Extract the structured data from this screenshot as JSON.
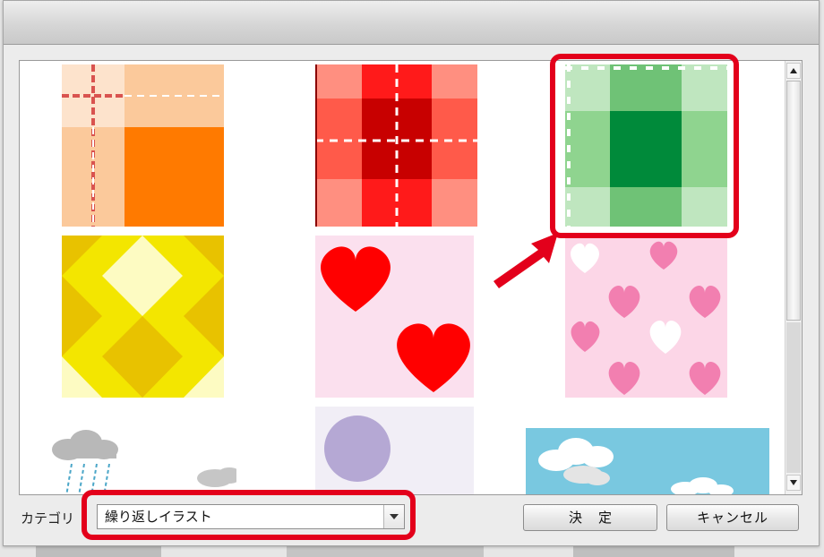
{
  "dialog": {
    "title": ""
  },
  "gallery": {
    "tiles": [
      {
        "name": "orange-stitched-plaid",
        "colors": {
          "base": "#ff7a00",
          "light": "#fbc99b",
          "pale": "#fde3cc",
          "stitch": "#d9534f"
        }
      },
      {
        "name": "red-stitched-plaid",
        "colors": {
          "base": "#ff1a1a",
          "dark": "#c80000",
          "light": "#ff8f80"
        }
      },
      {
        "name": "green-stitched-plaid",
        "colors": {
          "dark": "#008a3a",
          "mid": "#6fc276",
          "light": "#bfe6bf"
        }
      },
      {
        "name": "yellow-argyle",
        "colors": {
          "base": "#f3e600",
          "light": "#fdfbc2",
          "dark": "#e8c200"
        }
      },
      {
        "name": "red-hearts-on-pink",
        "colors": {
          "bg": "#fbe0ee",
          "heart": "#ff0000"
        }
      },
      {
        "name": "pink-hearts-pattern",
        "colors": {
          "bg": "#fcd6e7",
          "heart": "#f27fb0",
          "white": "#ffffff"
        }
      },
      {
        "name": "rain-clouds",
        "colors": {
          "cloud": "#b8b8b8",
          "rain": "#4aa6c8"
        }
      },
      {
        "name": "purple-circle",
        "colors": {
          "bg": "#f1eef6",
          "circle": "#b5a8d4"
        }
      },
      {
        "name": "sky-clouds",
        "colors": {
          "sky": "#79c8e0",
          "cloud": "#ffffff"
        }
      }
    ]
  },
  "footer": {
    "category_label": "カテゴリ",
    "category_selected": "繰り返しイラスト",
    "ok_label": "決定",
    "cancel_label": "キャンセル"
  },
  "icons": {
    "scroll_up": "triangle-up",
    "scroll_down": "triangle-down",
    "dropdown": "triangle-down"
  },
  "annotations": {
    "highlight_color": "#e3001b"
  }
}
